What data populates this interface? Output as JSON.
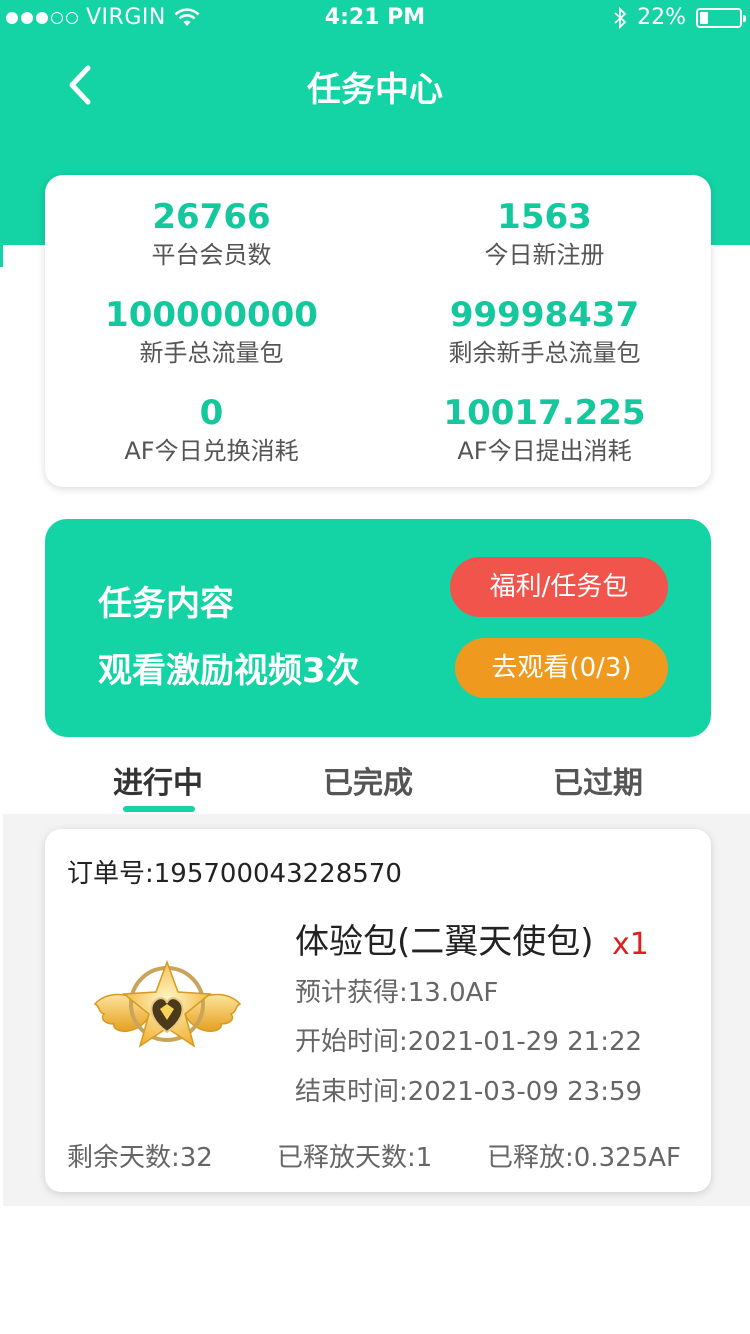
{
  "status_bar": {
    "carrier": "VIRGIN",
    "time": "4:21 PM",
    "battery_text": "22%",
    "battery_level": 0.22
  },
  "nav": {
    "title": "任务中心",
    "back_icon": "chevron-left-icon"
  },
  "stats": [
    {
      "value": "26766",
      "label": "平台会员数"
    },
    {
      "value": "1563",
      "label": "今日新注册"
    },
    {
      "value": "100000000",
      "label": "新手总流量包"
    },
    {
      "value": "99998437",
      "label": "剩余新手总流量包"
    },
    {
      "value": "0",
      "label": "AF今日兑换消耗"
    },
    {
      "value": "10017.225",
      "label": "AF今日提出消耗"
    }
  ],
  "task": {
    "title": "任务内容",
    "description": "观看激励视频3次",
    "welfare_button": "福利/任务包",
    "watch_button": "去观看(0/3)"
  },
  "tabs": [
    {
      "label": "进行中",
      "active": true
    },
    {
      "label": "已完成",
      "active": false
    },
    {
      "label": "已过期",
      "active": false
    }
  ],
  "order": {
    "order_no": "订单号:195700043228570",
    "product_name": "体验包(二翼天使包)",
    "quantity": "x1",
    "expected": "预计获得:13.0AF",
    "start_time": "开始时间:2021-01-29 21:22",
    "end_time": "结束时间:2021-03-09 23:59",
    "remaining_days": "剩余天数:32",
    "released_days": "已释放天数:1",
    "released": "已释放:0.325AF"
  },
  "colors": {
    "accent": "#14d3a5",
    "welfare_button": "#f0544a",
    "watch_button": "#ef9a1e",
    "quantity": "#e01e1e"
  }
}
